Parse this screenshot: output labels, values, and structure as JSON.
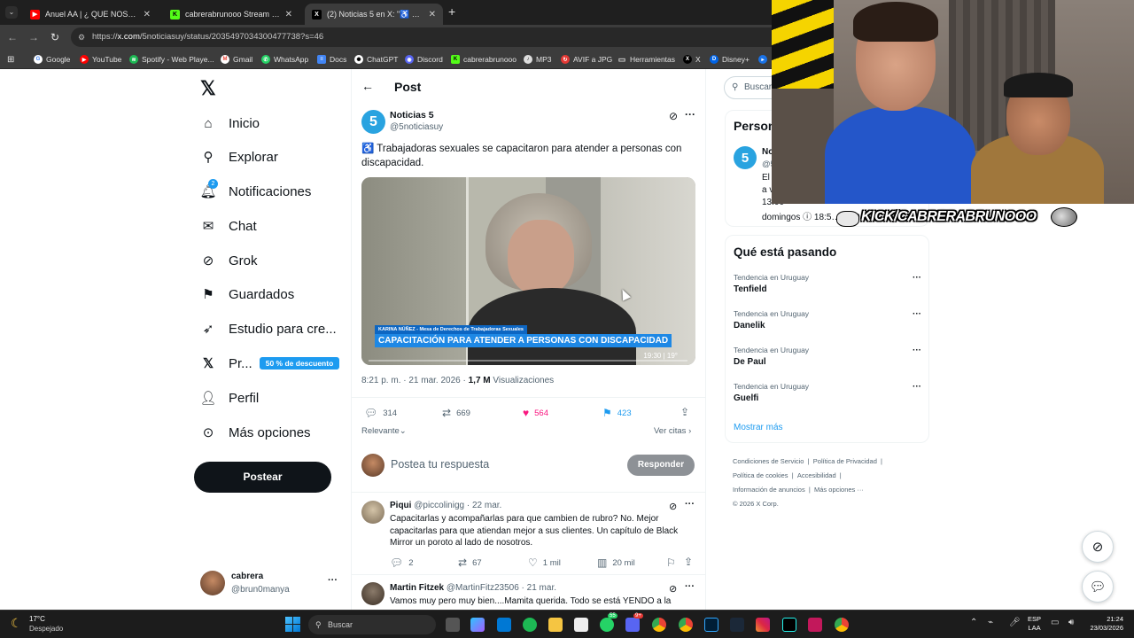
{
  "browser": {
    "tabs": [
      {
        "label": "Anuel AA | ¿ QUE NOS PASO ? -",
        "favicon": "youtube-icon"
      },
      {
        "label": "cabrerabrunooo Stream - Watc",
        "favicon": "kick-icon"
      },
      {
        "label": "(2) Noticias 5 en X: \"♿ Tra",
        "favicon": "x-icon"
      }
    ],
    "new_tab": "+",
    "url_prefix": "https://",
    "url_host": "x.com",
    "url_path": "/5noticiasuy/status/2035497034300477738?s=46",
    "bookmarks": [
      "Google",
      "YouTube",
      "Spotify - Web Playe...",
      "Gmail",
      "WhatsApp",
      "Docs",
      "ChatGPT",
      "Discord",
      "cabrerabrunooo",
      "MP3",
      "AVIF a JPG",
      "Herramientas",
      "X",
      "Disney+"
    ]
  },
  "left_nav": {
    "items": [
      "Inicio",
      "Explorar",
      "Notificaciones",
      "Chat",
      "Grok",
      "Guardados",
      "Estudio para cre...",
      "Pr...",
      "Perfil",
      "Más opciones"
    ],
    "notif_badge": "2",
    "promo_badge": "50 % de descuento",
    "post_button": "Postear",
    "account_name": "cabrera",
    "account_handle": "@brun0manya",
    "more": "···"
  },
  "main": {
    "header_title": "Post",
    "post": {
      "author": "Noticias 5",
      "handle": "@5noticiasuy",
      "text": "♿ Trabajadoras sexuales se capacitaron para atender a personas con discapacidad.",
      "video_caption_name": "KARINA NÚÑEZ - Mesa de Derechos de Trabajadoras Sexuales",
      "video_caption_title": "CAPACITACIÓN PARA ATENDER A PERSONAS CON DISCAPACIDAD",
      "video_time": "19:30 | 19°",
      "timestamp": "8:21 p. m. · 21 mar. 2026 ·",
      "views_count": "1,7 M",
      "views_label": "Visualizaciones",
      "replies": "314",
      "reposts": "669",
      "likes": "564",
      "bookmarks": "423"
    },
    "sort_label": "Relevante",
    "view_quotes": "Ver citas",
    "reply_placeholder": "Postea tu respuesta",
    "reply_button": "Responder",
    "replies": [
      {
        "author": "Piqui",
        "handle": "@piccolinigg",
        "date": "· 22 mar.",
        "text": "Capacitarlas y acompañarlas para que cambien de rubro? No. Mejor capacitarlas para que atiendan mejor a sus clientes. Un capítulo de Black Mirror un poroto al lado de nosotros.",
        "replies": "2",
        "reposts": "67",
        "likes": "1 mil",
        "views": "20 mil"
      },
      {
        "author": "Martin Fitzek",
        "handle": "@MartinFitz23506",
        "date": "· 21 mar.",
        "text": "Vamos muy pero muy bien....Mamita querida. Todo se está YENDO a la"
      }
    ]
  },
  "right": {
    "search_placeholder": "Buscar",
    "related_title": "Person",
    "related_name": "No",
    "related_handle": "@5",
    "related_bio_lines": [
      "El",
      "a v",
      "13:00",
      "domingos  ⓘ 18:5…  20:0…"
    ],
    "trending_title": "Qué está pasando",
    "trends": [
      {
        "context": "Tendencia en Uruguay",
        "name": "Tenfield"
      },
      {
        "context": "Tendencia en Uruguay",
        "name": "Danelik"
      },
      {
        "context": "Tendencia en Uruguay",
        "name": "De Paul"
      },
      {
        "context": "Tendencia en Uruguay",
        "name": "Guelfi"
      }
    ],
    "show_more": "Mostrar más",
    "footer_links": [
      "Condiciones de Servicio",
      "Política de Privacidad",
      "Política de cookies",
      "Accesibilidad",
      "Información de anuncios",
      "Más opciones ···",
      "© 2026 X Corp."
    ]
  },
  "overlay": {
    "stream_banner": "KICK/CABRERABRUNOOO"
  },
  "taskbar": {
    "weather_temp": "17°C",
    "weather_desc": "Despejado",
    "search_placeholder": "Buscar",
    "badge_a": "55",
    "badge_b": "9+",
    "lang_1": "ESP",
    "lang_2": "LAA",
    "time": "21:24",
    "date": "23/03/2026"
  }
}
